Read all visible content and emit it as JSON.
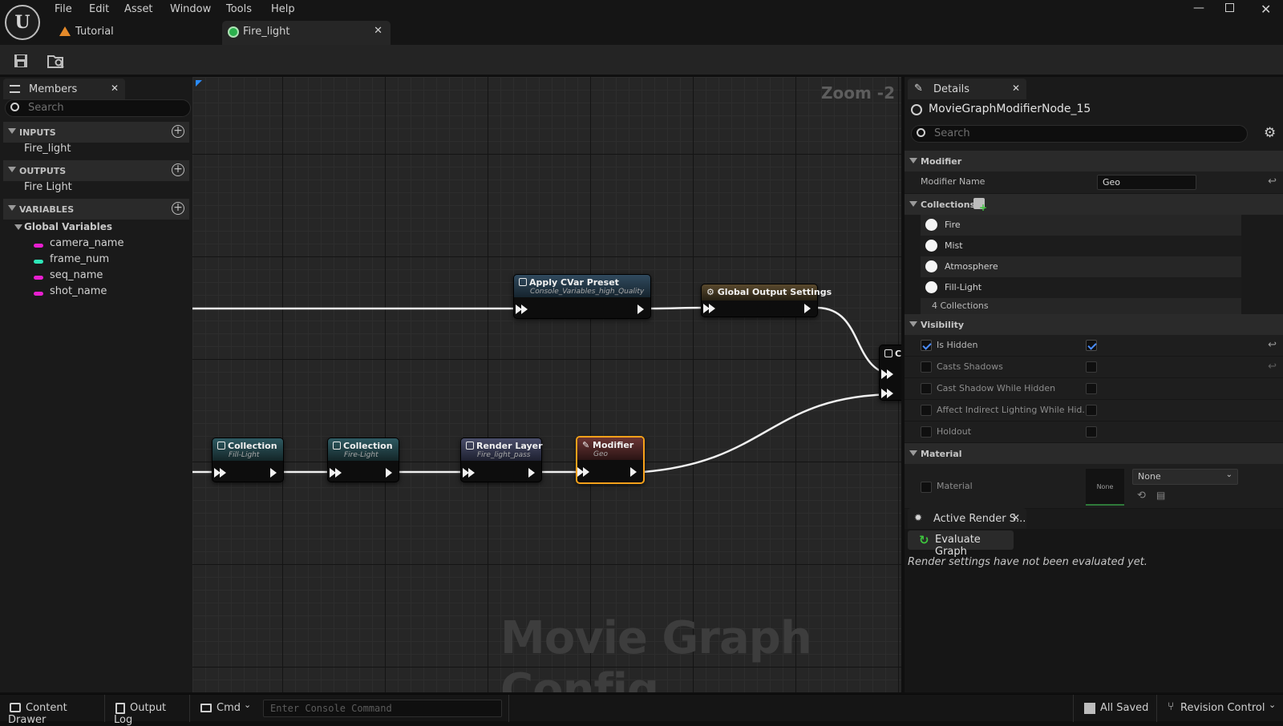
{
  "menu": [
    "File",
    "Edit",
    "Asset",
    "Window",
    "Tools",
    "Help"
  ],
  "tabs": {
    "tutorial": "Tutorial",
    "fire_light": "Fire_light"
  },
  "members": {
    "tab_label": "Members",
    "search_placeholder": "Search",
    "inputs_label": "INPUTS",
    "inputs": [
      "Fire_light"
    ],
    "outputs_label": "OUTPUTS",
    "outputs": [
      "Fire Light"
    ],
    "variables_label": "VARIABLES",
    "global_variables_label": "Global Variables",
    "variables": [
      {
        "name": "camera_name",
        "color": "#e81fd0"
      },
      {
        "name": "frame_num",
        "color": "#2ee6b8"
      },
      {
        "name": "seq_name",
        "color": "#e81fd0"
      },
      {
        "name": "shot_name",
        "color": "#e81fd0"
      }
    ]
  },
  "graph": {
    "zoom_label": "Zoom -2",
    "watermark": "Movie Graph Config",
    "nodes": {
      "apply_cvar": {
        "title": "Apply CVar Preset",
        "subtitle": "Console_Variables_high_Quality",
        "color": "#304a5e"
      },
      "global_output": {
        "title": "Global Output Settings",
        "subtitle": "",
        "color": "#5a4a2e"
      },
      "collection1": {
        "title": "Collection",
        "subtitle": "Fill-Light",
        "color": "#2e5a62"
      },
      "collection2": {
        "title": "Collection",
        "subtitle": "Fire-Light",
        "color": "#2e5a62"
      },
      "render_layer": {
        "title": "Render Layer",
        "subtitle": "Fire_light_pass",
        "color": "#4a4e6a"
      },
      "modifier": {
        "title": "Modifier",
        "subtitle": "Geo",
        "color": "#6a3535",
        "selected_color": "#f7a11a"
      },
      "output_partial": {
        "title": "C"
      }
    }
  },
  "details": {
    "tab_label": "Details",
    "object_name": "MovieGraphModifierNode_15",
    "search_placeholder": "Search",
    "modifier_category": "Modifier",
    "modifier_name_label": "Modifier Name",
    "modifier_name_value": "Geo",
    "collections_category": "Collections",
    "collections": [
      "Fire",
      "Mist",
      "Atmosphere",
      "Fill-Light"
    ],
    "collections_count": "4 Collections",
    "visibility_category": "Visibility",
    "visibility": [
      {
        "label": "Is Hidden",
        "enabled": true,
        "checked": true,
        "value": true
      },
      {
        "label": "Casts Shadows",
        "enabled": false,
        "checked": false,
        "value": false
      },
      {
        "label": "Cast Shadow While Hidden",
        "enabled": false,
        "checked": false,
        "value": false
      },
      {
        "label": "Affect Indirect Lighting While Hid...",
        "enabled": false,
        "checked": false,
        "value": false
      },
      {
        "label": "Holdout",
        "enabled": false,
        "checked": false,
        "value": false
      }
    ],
    "material_category": "Material",
    "material_label": "Material",
    "material_thumb_label": "None",
    "material_value": "None"
  },
  "render_settings": {
    "tab_label": "Active Render S...",
    "evaluate_button": "Evaluate Graph",
    "status_text": "Render settings have not been evaluated yet."
  },
  "bottom": {
    "content_drawer": "Content Drawer",
    "output_log": "Output Log",
    "cmd": "Cmd",
    "console_placeholder": "Enter Console Command",
    "all_saved": "All Saved",
    "revision_control": "Revision Control"
  }
}
